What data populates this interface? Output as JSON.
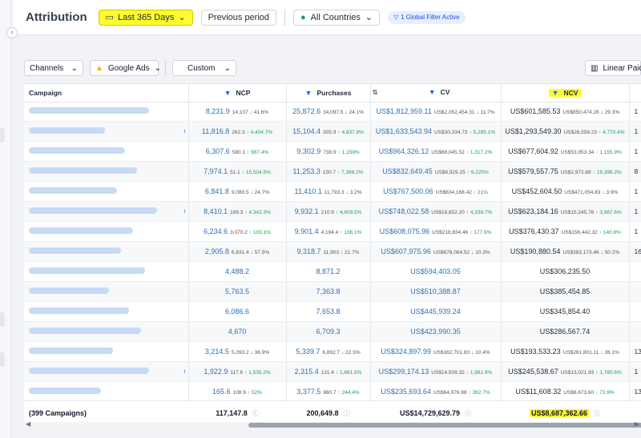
{
  "header": {
    "title": "Attribution",
    "date_range": "Last 365 Days",
    "previous_period": "Previous period",
    "countries": "All Countries",
    "filter_badge": "1 Global Filter Active"
  },
  "filters": {
    "channels": "Channels",
    "source": "Google Ads",
    "custom": "Custom",
    "model": "Linear Paid"
  },
  "columns": {
    "campaign": "Campaign",
    "ncp": "NCP",
    "purchases": "Purchases",
    "cv": "CV",
    "ncv": "NCV"
  },
  "rows": [
    {
      "ncp": "8,231.9",
      "ncp_p": "14,107",
      "ncp_c": "41.6%",
      "ncp_d": "dn",
      "pur": "25,872.6",
      "pur_p": "34,097.5",
      "pur_c": "24.1%",
      "pur_d": "dn",
      "cv": "US$1,812,959.11",
      "cv_p": "US$2,052,454.31",
      "cv_c": "11.7%",
      "cv_d": "dn",
      "ncv": "US$601,585.53",
      "ncv_p": "US$850,474.28",
      "ncv_c": "29.3%",
      "ncv_d": "dn",
      "ext": "1"
    },
    {
      "ncp": "11,816.8",
      "ncp_p": "262.3",
      "ncp_c": "4,404.7%",
      "ncp_d": "up",
      "pur": "15,104.4",
      "pur_p": "305.9",
      "pur_c": "4,837.8%",
      "pur_d": "up",
      "cv": "US$1,633,543.94",
      "cv_p": "US$30,334.73",
      "cv_c": "5,285.1%",
      "cv_d": "up",
      "ncv": "US$1,293,549.30",
      "ncv_p": "US$26,559.23",
      "ncv_c": "4,770.4%",
      "ncv_d": "up",
      "ext": "1"
    },
    {
      "ncp": "6,307.6",
      "ncp_p": "580.1",
      "ncp_c": "987.4%",
      "ncp_d": "up",
      "pur": "9,302.9",
      "pur_p": "738.9",
      "pur_c": "1,159%",
      "pur_d": "up",
      "cv": "US$964,326.12",
      "cv_p": "US$68,045.52",
      "cv_c": "1,317.2%",
      "cv_d": "up",
      "ncv": "US$677,604.92",
      "ncv_p": "US$53,953.34",
      "ncv_c": "1,155.9%",
      "ncv_d": "up",
      "ext": "1"
    },
    {
      "ncp": "7,974.1",
      "ncp_p": "51.1",
      "ncp_c": "15,504.5%",
      "ncp_d": "up",
      "pur": "11,253.3",
      "pur_p": "150.7",
      "pur_c": "7,369.2%",
      "pur_d": "up",
      "cv": "US$832,649.45",
      "cv_p": "US$8,929.25",
      "cv_c": "9,225%",
      "cv_d": "up",
      "ncv": "US$579,557.75",
      "ncv_p": "US$2,972.68",
      "ncv_c": "19,396.2%",
      "ncv_d": "up",
      "ext": "8"
    },
    {
      "ncp": "6,841.8",
      "ncp_p": "9,080.5",
      "ncp_c": "24.7%",
      "ncp_d": "dn",
      "pur": "11,410.1",
      "pur_p": "11,793.3",
      "pur_c": "3.2%",
      "pur_d": "dn",
      "cv": "US$767,500.06",
      "cv_p": "US$634,168.42",
      "cv_c": "21%",
      "cv_d": "up",
      "ncv": "US$452,604.50",
      "ncv_p": "US$471,054.83",
      "ncv_c": "3.9%",
      "ncv_d": "dn",
      "ext": "1"
    },
    {
      "ncp": "8,410.1",
      "ncp_p": "189.3",
      "ncp_c": "4,342.3%",
      "ncp_d": "up",
      "pur": "9,932.1",
      "pur_p": "210.9",
      "pur_c": "4,609.5%",
      "pur_d": "up",
      "cv": "US$748,022.58",
      "cv_p": "US$16,852.20",
      "cv_c": "4,338.7%",
      "cv_d": "up",
      "ncv": "US$623,184.16",
      "ncv_p": "US$15,245.76",
      "ncv_c": "3,987.6%",
      "ncv_d": "up",
      "ext": "1"
    },
    {
      "ncp": "6,234.6",
      "ncp_p": "3,070.2",
      "ncp_c": "103.1%",
      "ncp_d": "up",
      "pur": "9,901.4",
      "pur_p": "4,194.4",
      "pur_c": "136.1%",
      "pur_d": "up",
      "cv": "US$608,075.96",
      "cv_p": "US$218,834.46",
      "cv_c": "177.9%",
      "cv_d": "up",
      "ncv": "US$376,430.37",
      "ncv_p": "US$156,442.32",
      "ncv_c": "140.6%",
      "ncv_d": "up",
      "ext": "1"
    },
    {
      "ncp": "2,905.8",
      "ncp_p": "6,831.4",
      "ncp_c": "57.5%",
      "ncp_d": "dn",
      "pur": "9,318.7",
      "pur_p": "11,903",
      "pur_c": "21.7%",
      "pur_d": "dn",
      "cv": "US$607,975.96",
      "cv_p": "US$678,084.52",
      "cv_c": "10.3%",
      "cv_d": "dn",
      "ncv": "US$190,880.54",
      "ncv_p": "US$383,173.46",
      "ncv_c": "50.2%",
      "ncv_d": "dn",
      "ext": "16"
    },
    {
      "ncp": "4,488.2",
      "pur": "8,871.2",
      "cv": "US$594,403.05",
      "ncv": "US$306,235.50",
      "ext": ""
    },
    {
      "ncp": "5,763.5",
      "pur": "7,363.8",
      "cv": "US$510,388.87",
      "ncv": "US$385,454.85",
      "ext": ""
    },
    {
      "ncp": "6,086.6",
      "pur": "7,653.8",
      "cv": "US$445,939.24",
      "ncv": "US$345,854.40",
      "ext": ""
    },
    {
      "ncp": "4,670",
      "pur": "6,709.3",
      "cv": "US$423,990.35",
      "ncv": "US$286,567.74",
      "ext": ""
    },
    {
      "ncp": "3,214.5",
      "ncp_p": "5,093.2",
      "ncp_c": "36.9%",
      "ncp_d": "dn",
      "pur": "5,339.7",
      "pur_p": "6,892.7",
      "pur_c": "22.5%",
      "pur_d": "dn",
      "cv": "US$324,897.99",
      "cv_p": "US$362,701.83",
      "cv_c": "10.4%",
      "cv_d": "dn",
      "ncv": "US$193,533.23",
      "ncv_p": "US$261,801.11",
      "ncv_c": "26.1%",
      "ncv_d": "dn",
      "ext": "13"
    },
    {
      "ncp": "1,922.9",
      "ncp_p": "117.6",
      "ncp_c": "1,535.2%",
      "ncp_d": "up",
      "pur": "2,315.4",
      "pur_p": "131.4",
      "pur_c": "1,661.5%",
      "pur_d": "up",
      "cv": "US$299,174.13",
      "cv_p": "US$14,509.32",
      "cv_c": "1,961.9%",
      "cv_d": "up",
      "ncv": "US$245,538.67",
      "ncv_p": "US$13,021.93",
      "ncv_c": "1,785.6%",
      "ncv_d": "up",
      "ext": "1"
    },
    {
      "ncp": "165.6",
      "ncp_p": "108.9",
      "ncp_c": "52%",
      "ncp_d": "up",
      "pur": "3,377.5",
      "pur_p": "980.7",
      "pur_c": "244.4%",
      "pur_d": "up",
      "cv": "US$235,693.64",
      "cv_p": "US$64,976.98",
      "cv_c": "262.7%",
      "cv_d": "up",
      "ncv": "US$11,608.32",
      "ncv_p": "US$6,673.60",
      "ncv_c": "73.9%",
      "ncv_d": "up",
      "ext": "13"
    }
  ],
  "totals": {
    "campaigns": "(399 Campaigns)",
    "ncp": "117,147.8",
    "purchases": "200,649.8",
    "cv": "US$14,729,629.79",
    "ncv": "US$8,687,362.66"
  },
  "icons": {
    "up": "↑",
    "down": "↓",
    "info": "ⓘ"
  }
}
